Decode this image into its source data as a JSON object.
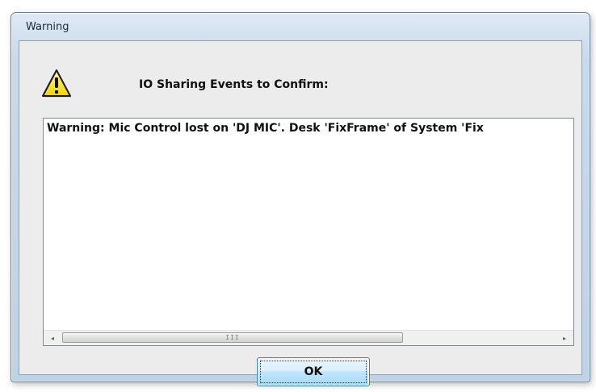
{
  "window": {
    "title": "Warning"
  },
  "dialog": {
    "icon": "warning-icon",
    "heading": "IO Sharing Events to Confirm:",
    "message_lines": [
      "Warning: Mic Control lost on 'DJ MIC'. Desk 'FixFrame' of System 'Fix"
    ],
    "ok_label": "OK"
  },
  "scrollbar": {
    "left_arrow": "◂",
    "right_arrow": "▸",
    "grip": "III"
  },
  "colors": {
    "frame": "#c9daea",
    "client_bg": "#ececec",
    "warning_yellow": "#f8e21c",
    "button_accent": "#3c7fb1"
  }
}
